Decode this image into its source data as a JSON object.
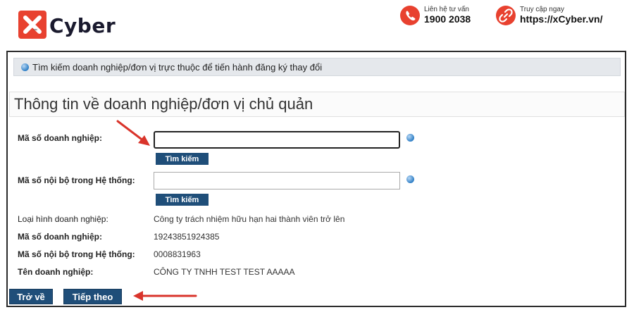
{
  "header": {
    "brand": "Cyber",
    "brand_tm": "™",
    "hotline_label": "Liên hệ tư vấn",
    "hotline_number": "1900 2038",
    "visit_label": "Truy cập ngay",
    "visit_url": "https://xCyber.vn/",
    "accent_color": "#e8412f"
  },
  "search_bar": {
    "text": "Tìm kiếm doanh nghiệp/đơn vị trực thuộc để tiến hành đăng ký thay đổi"
  },
  "section": {
    "title": "Thông tin về doanh nghiệp/đơn vị chủ quản"
  },
  "form": {
    "business_code_label": "Mã số doanh nghiệp:",
    "business_code_value": "",
    "internal_code_label": "Mã số nội bộ trong Hệ thống:",
    "internal_code_value": "",
    "search_button": "Tìm kiếm"
  },
  "details": [
    {
      "label": "Loại hình doanh nghiệp:",
      "value": "Công ty trách nhiệm hữu hạn hai thành viên trở lên"
    },
    {
      "label": "Mã số doanh nghiệp:",
      "value": "19243851924385"
    },
    {
      "label": "Mã số nội bộ trong Hệ thống:",
      "value": "0008831963"
    },
    {
      "label": "Tên doanh nghiệp:",
      "value": "CÔNG TY TNHH TEST TEST AAAAA"
    }
  ],
  "nav": {
    "back_label": "Trở về",
    "next_label": "Tiếp theo"
  },
  "colors": {
    "button": "#1f4e79",
    "annotation_arrow": "#d9342b"
  }
}
